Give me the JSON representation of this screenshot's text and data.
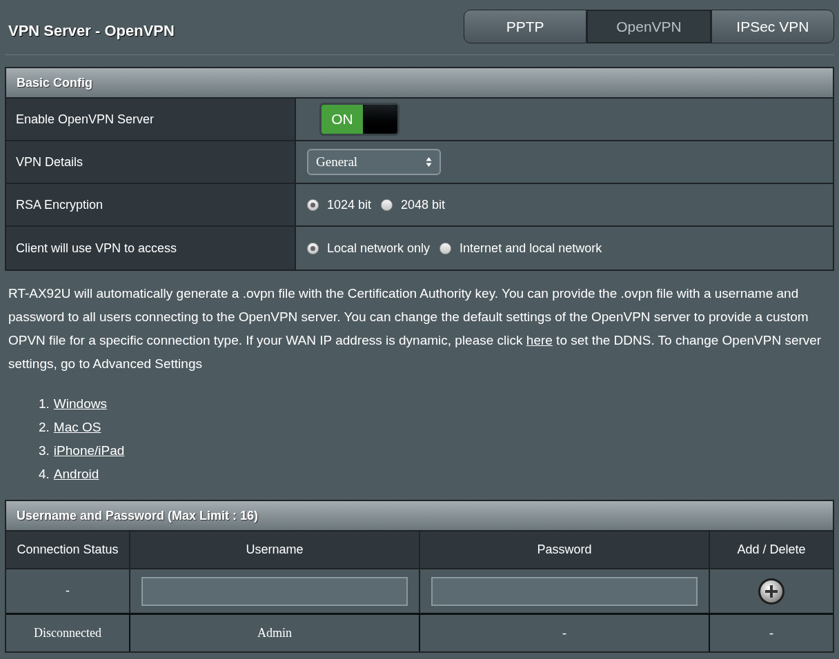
{
  "page_title": "VPN Server - OpenVPN",
  "tabs": [
    {
      "label": "PPTP",
      "selected": false
    },
    {
      "label": "OpenVPN",
      "selected": true
    },
    {
      "label": "IPSec VPN",
      "selected": false
    }
  ],
  "basic_config": {
    "title": "Basic Config",
    "rows": [
      {
        "kind": "toggle",
        "label": "Enable OpenVPN Server",
        "on": true,
        "toggle_label": "ON"
      },
      {
        "kind": "select",
        "label": "VPN Details",
        "value": "General"
      },
      {
        "kind": "radio",
        "label": "RSA Encryption",
        "options": [
          {
            "label": "1024 bit",
            "selected": true
          },
          {
            "label": "2048 bit",
            "selected": false
          }
        ]
      },
      {
        "kind": "radio",
        "label": "Client will use VPN to access",
        "options": [
          {
            "label": "Local network only",
            "selected": true
          },
          {
            "label": "Internet and local network",
            "selected": false
          }
        ]
      }
    ]
  },
  "description": {
    "before": "RT-AX92U will automatically generate a .ovpn file with the Certification Authority key. You can provide the .ovpn file with a username and password to all users connecting to the OpenVPN server. You can change the default settings of the OpenVPN server to provide a custom OPVN file for a specific connection type. If your WAN IP address is dynamic, please click",
    "link": "here",
    "after": "to set the DDNS. To change OpenVPN server settings, go to Advanced Settings"
  },
  "client_links": [
    {
      "number": "1.",
      "label": "Windows"
    },
    {
      "number": "2.",
      "label": "Mac OS"
    },
    {
      "number": "3.",
      "label": "iPhone/iPad"
    },
    {
      "number": "4.",
      "label": "Android"
    }
  ],
  "users": {
    "title": "Username and Password (Max Limit : 16)",
    "columns": [
      "Connection Status",
      "Username",
      "Password",
      "Add / Delete"
    ],
    "new_entry": {
      "status": "-"
    },
    "rows": [
      {
        "status": "Disconnected",
        "username": "Admin",
        "password": "-",
        "action": "-"
      }
    ]
  }
}
